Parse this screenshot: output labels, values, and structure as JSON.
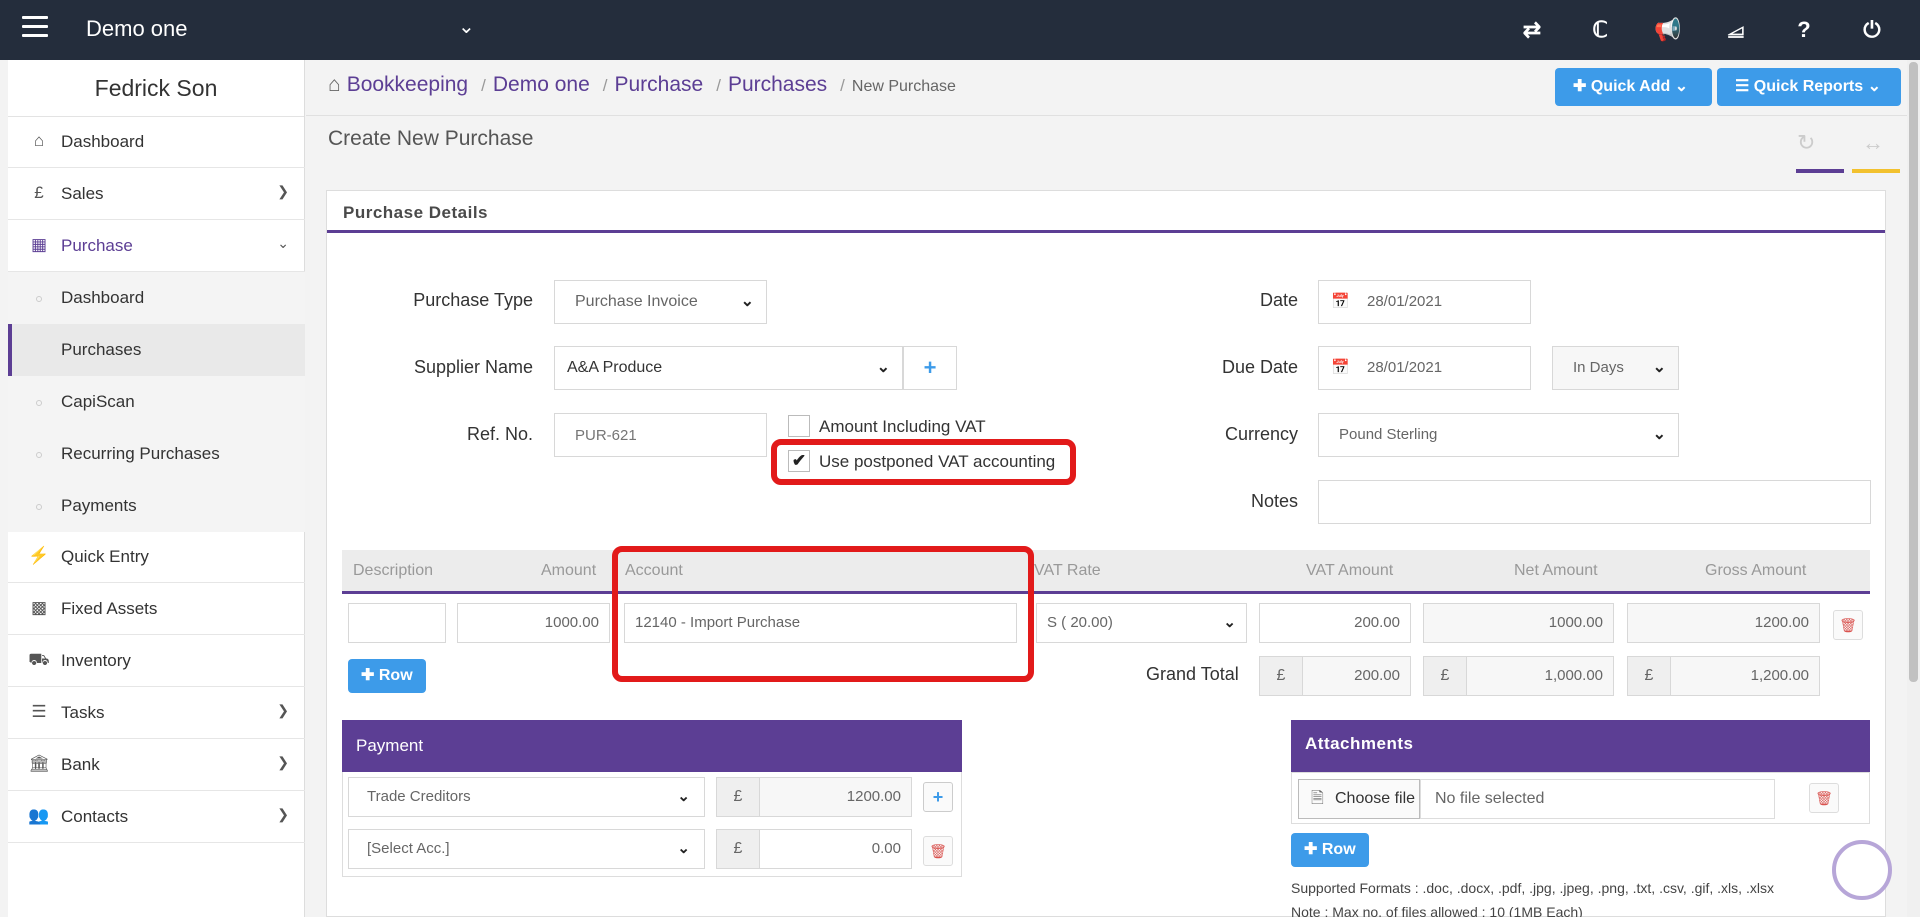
{
  "topbar": {
    "app_name": "Demo one"
  },
  "sidebar": {
    "user_name": "Fedrick Son",
    "items": [
      {
        "label": "Dashboard"
      },
      {
        "label": "Sales"
      },
      {
        "label": "Purchase"
      },
      {
        "label": "Quick Entry"
      },
      {
        "label": "Fixed Assets"
      },
      {
        "label": "Inventory"
      },
      {
        "label": "Tasks"
      },
      {
        "label": "Bank"
      },
      {
        "label": "Contacts"
      }
    ],
    "purchase_sub": [
      {
        "label": "Dashboard"
      },
      {
        "label": "Purchases"
      },
      {
        "label": "CapiScan"
      },
      {
        "label": "Recurring Purchases"
      },
      {
        "label": "Payments"
      }
    ]
  },
  "breadcrumb": {
    "b1": "Bookkeeping",
    "b2": "Demo one",
    "b3": "Purchase",
    "b4": "Purchases",
    "current": "New Purchase"
  },
  "buttons": {
    "quick_add": "Quick Add",
    "quick_reports": "Quick Reports",
    "row": "Row"
  },
  "page": {
    "title": "Create New Purchase",
    "panel_title": "Purchase Details"
  },
  "form": {
    "purchase_type_label": "Purchase Type",
    "purchase_type": "Purchase Invoice",
    "supplier_label": "Supplier Name",
    "supplier": "A&A Produce",
    "ref_label": "Ref. No.",
    "ref_placeholder": "PUR-621",
    "amount_incl_vat": "Amount Including VAT",
    "postponed_vat": "Use postponed VAT accounting",
    "date_label": "Date",
    "date": "28/01/2021",
    "due_label": "Due Date",
    "due_date": "28/01/2021",
    "due_unit": "In Days",
    "currency_label": "Currency",
    "currency": "Pound Sterling",
    "notes_label": "Notes"
  },
  "lines": {
    "headers": [
      "Description",
      "Amount",
      "Account",
      "VAT Rate",
      "VAT Amount",
      "Net Amount",
      "Gross Amount"
    ],
    "row": {
      "amount": "1000.00",
      "account": "12140 - Import Purchase",
      "vat_rate": "S ( 20.00)",
      "vat_amount": "200.00",
      "net": "1000.00",
      "gross": "1200.00"
    },
    "grand_total_label": "Grand Total",
    "currency_symbol": "£",
    "totals": {
      "vat": "200.00",
      "net": "1,000.00",
      "gross": "1,200.00"
    }
  },
  "payment": {
    "title": "Payment",
    "rows": [
      {
        "account": "Trade Creditors",
        "amount": "1200.00"
      },
      {
        "account": "[Select Acc.]",
        "amount": "0.00"
      }
    ]
  },
  "attachments": {
    "title": "Attachments",
    "choose": "Choose file",
    "none": "No file selected",
    "formats": "Supported Formats : .doc, .docx, .pdf, .jpg, .jpeg, .png, .txt, .csv, .gif, .xls, .xlsx",
    "note": "Note : Max no. of files allowed : 10 (1MB Each)"
  },
  "colors": {
    "brand_purple": "#5c3e94",
    "accent_blue": "#3d9be9",
    "highlight_red": "#e21a1a",
    "topbar": "#242d3c"
  }
}
